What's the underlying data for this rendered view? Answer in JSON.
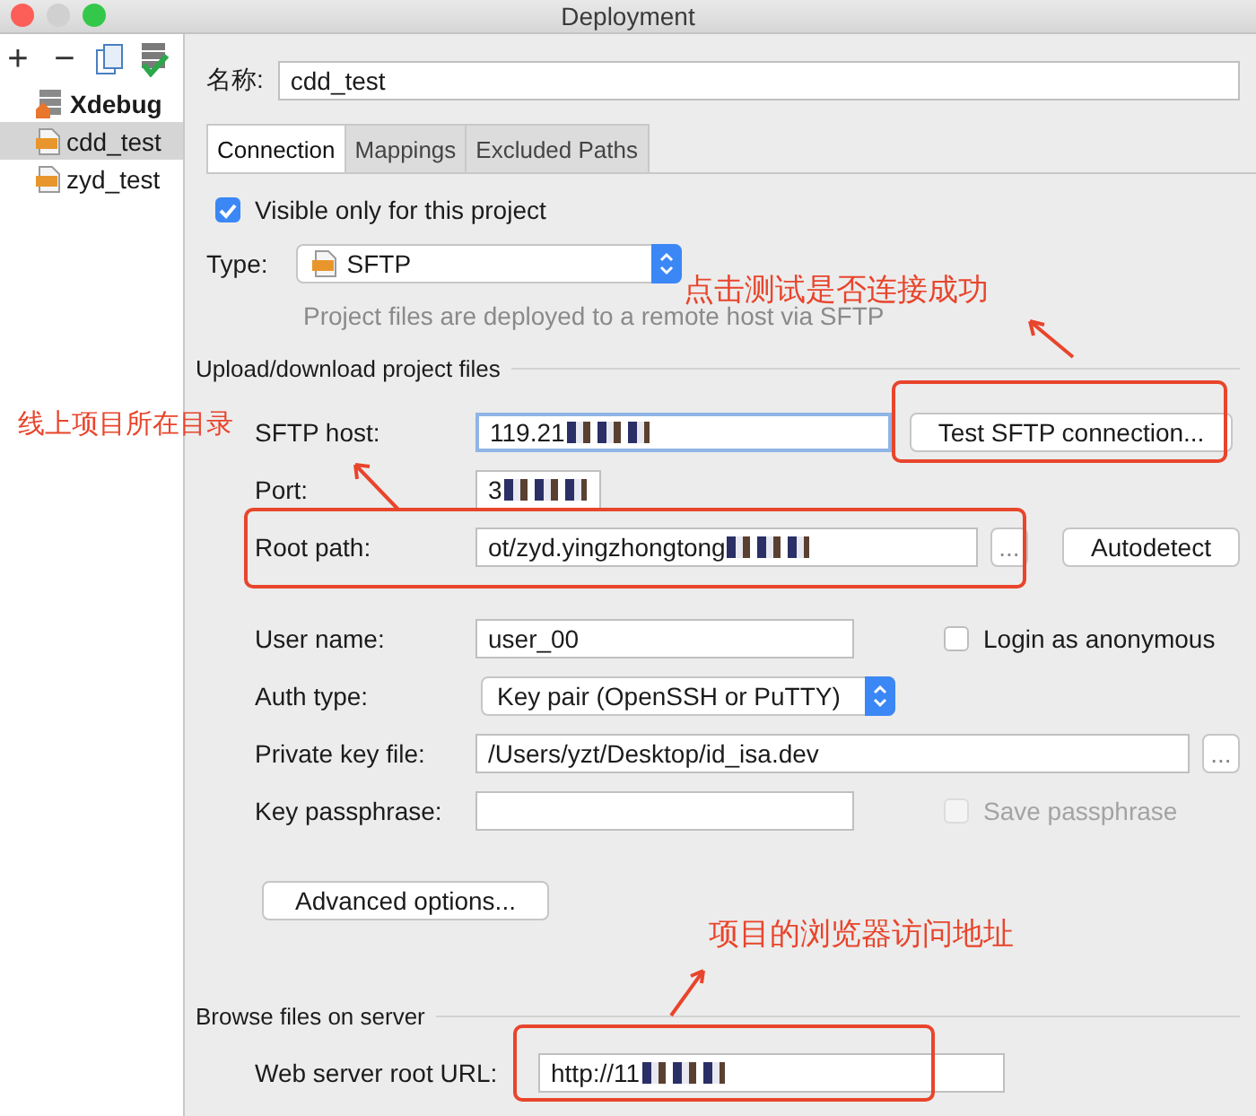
{
  "window": {
    "title": "Deployment"
  },
  "toolbar": [
    {
      "kind": "add",
      "label": "+"
    },
    {
      "kind": "remove",
      "label": "−"
    },
    {
      "kind": "copy"
    },
    {
      "kind": "default"
    }
  ],
  "servers": [
    {
      "name": "Xdebug",
      "kind": "xdebug",
      "default": true,
      "selected": false
    },
    {
      "name": "cdd_test",
      "kind": "sftp",
      "default": false,
      "selected": true
    },
    {
      "name": "zyd_test",
      "kind": "sftp",
      "default": false,
      "selected": false
    }
  ],
  "name_field": {
    "label": "名称:",
    "value": "cdd_test"
  },
  "tabs": [
    {
      "label": "Connection",
      "selected": true
    },
    {
      "label": "Mappings",
      "selected": false
    },
    {
      "label": "Excluded Paths",
      "selected": false
    }
  ],
  "visible_only": {
    "label": "Visible only for this project",
    "checked": true
  },
  "type": {
    "label": "Type:",
    "value": "SFTP"
  },
  "type_description": "Project files are deployed to a remote host via SFTP",
  "upload_section": {
    "title": "Upload/download project files",
    "sftp_host": {
      "label": "SFTP host:",
      "value": "119.21",
      "focused": true,
      "redacted": true
    },
    "test_button": "Test SFTP connection...",
    "port": {
      "label": "Port:",
      "value": "3",
      "redacted": true
    },
    "root_path": {
      "label": "Root path:",
      "value": "ot/zyd.yingzhongtong",
      "redacted": true
    },
    "root_browse": "...",
    "autodetect_button": "Autodetect",
    "user_name": {
      "label": "User name:",
      "value": "user_00"
    },
    "anonymous": {
      "label": "Login as anonymous",
      "checked": false,
      "disabled": false
    },
    "auth_type": {
      "label": "Auth type:",
      "value": "Key pair (OpenSSH or PuTTY)"
    },
    "private_key": {
      "label": "Private key file:",
      "value": "/Users/yzt/Desktop/id_isa.dev"
    },
    "key_browse": "...",
    "passphrase": {
      "label": "Key passphrase:"
    },
    "save_passphrase": {
      "label": "Save passphrase",
      "checked": false,
      "disabled": true
    },
    "advanced_button": "Advanced options..."
  },
  "browse_section": {
    "title": "Browse files on server",
    "web_root_url": {
      "label": "Web server root URL:",
      "value": "http://11",
      "redacted": true
    }
  },
  "annotations": [
    {
      "text": "点击测试是否连接成功"
    },
    {
      "text": "线上项目所在目录"
    },
    {
      "text": "项目的浏览器访问地址"
    }
  ]
}
